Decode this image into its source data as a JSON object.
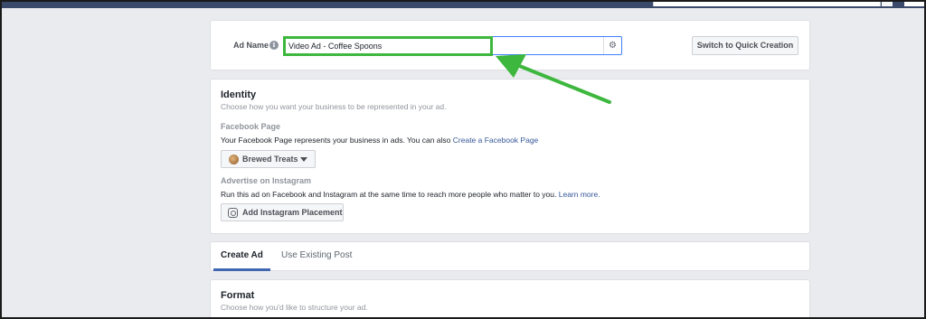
{
  "ad_name": {
    "label": "Ad Name",
    "value": "Video Ad - Coffee Spoons",
    "info_icon": "info-icon",
    "settings_icon": "gear-icon",
    "quick_creation_button": "Switch to Quick Creation"
  },
  "identity": {
    "title": "Identity",
    "subtitle": "Choose how you want your business to be represented in your ad.",
    "facebook_page": {
      "heading": "Facebook Page",
      "description": "Your Facebook Page represents your business in ads. You can also",
      "create_link": "Create a Facebook Page",
      "selected_page": "Brewed Treats"
    },
    "instagram": {
      "heading": "Advertise on Instagram",
      "description": "Run this ad on Facebook and Instagram at the same time to reach more people who matter to you.",
      "learn_more": "Learn more.",
      "button": "Add Instagram Placement"
    }
  },
  "tabs": [
    {
      "label": "Create Ad",
      "active": true
    },
    {
      "label": "Use Existing Post",
      "active": false
    }
  ],
  "format": {
    "title": "Format",
    "subtitle": "Choose how you'd like to structure your ad."
  },
  "annotation": {
    "highlight_color": "#3db73e"
  }
}
